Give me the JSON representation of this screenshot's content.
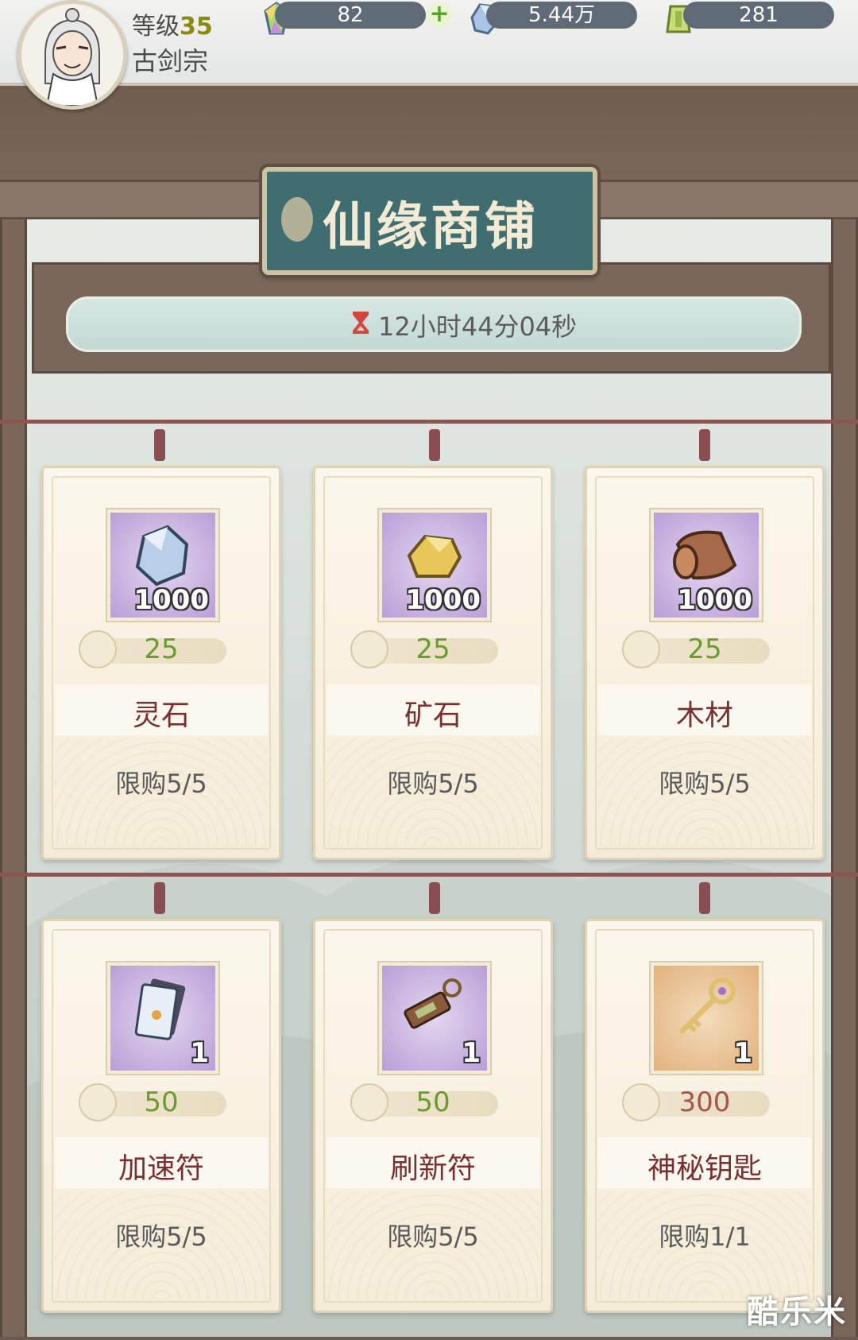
{
  "player": {
    "level_label": "等级",
    "level": "35",
    "sect": "古剑宗"
  },
  "resources": {
    "gem": "82",
    "crystal": "5.44万",
    "token": "281"
  },
  "shop": {
    "title": "仙缘商铺",
    "timer": "12小时44分04秒"
  },
  "items": [
    {
      "name": "灵石",
      "qty": "1000",
      "price": "25",
      "limit": "限购5/5",
      "icon": "spirit-stone-icon"
    },
    {
      "name": "矿石",
      "qty": "1000",
      "price": "25",
      "limit": "限购5/5",
      "icon": "ore-icon"
    },
    {
      "name": "木材",
      "qty": "1000",
      "price": "25",
      "limit": "限购5/5",
      "icon": "wood-icon"
    },
    {
      "name": "加速符",
      "qty": "1",
      "price": "50",
      "limit": "限购5/5",
      "icon": "speed-talisman-icon"
    },
    {
      "name": "刷新符",
      "qty": "1",
      "price": "50",
      "limit": "限购5/5",
      "icon": "refresh-talisman-icon"
    },
    {
      "name": "神秘钥匙",
      "qty": "1",
      "price": "300",
      "limit": "限购1/1",
      "icon": "mystery-key-icon"
    }
  ],
  "watermark": "酷乐米"
}
